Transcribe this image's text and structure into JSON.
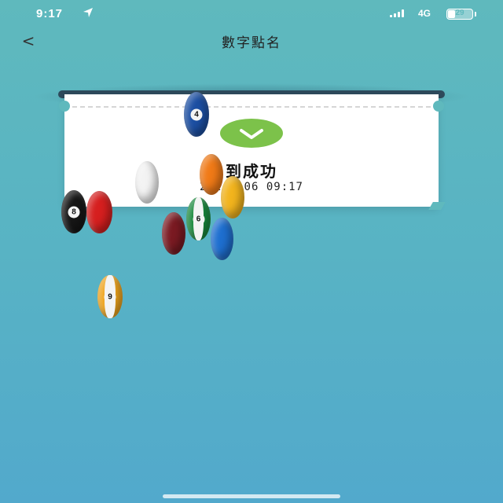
{
  "status_bar": {
    "time": "9:17",
    "network": "4G",
    "battery": "29",
    "battery_level": 0.29
  },
  "header": {
    "back_label": "<",
    "title": "數字點名"
  },
  "result": {
    "message": "到成功",
    "timestamp": "202 6-06 09:17",
    "status_color": "#7cc24a"
  },
  "balls": [
    {
      "number": "4",
      "color": "#1c4fa3"
    },
    {
      "number": "",
      "color": "#f07a17"
    },
    {
      "number": "",
      "color": "#f3f3f3"
    },
    {
      "number": "8",
      "color": "#161616"
    },
    {
      "number": "",
      "color": "#d61f1f"
    },
    {
      "number": "",
      "color": "#f2b41d"
    },
    {
      "number": "6",
      "color": "#1a8a3d"
    },
    {
      "number": "",
      "color": "#7a1a22"
    },
    {
      "number": "",
      "color": "#1e6fd0"
    },
    {
      "number": "9",
      "color": "#f0a51d"
    }
  ]
}
